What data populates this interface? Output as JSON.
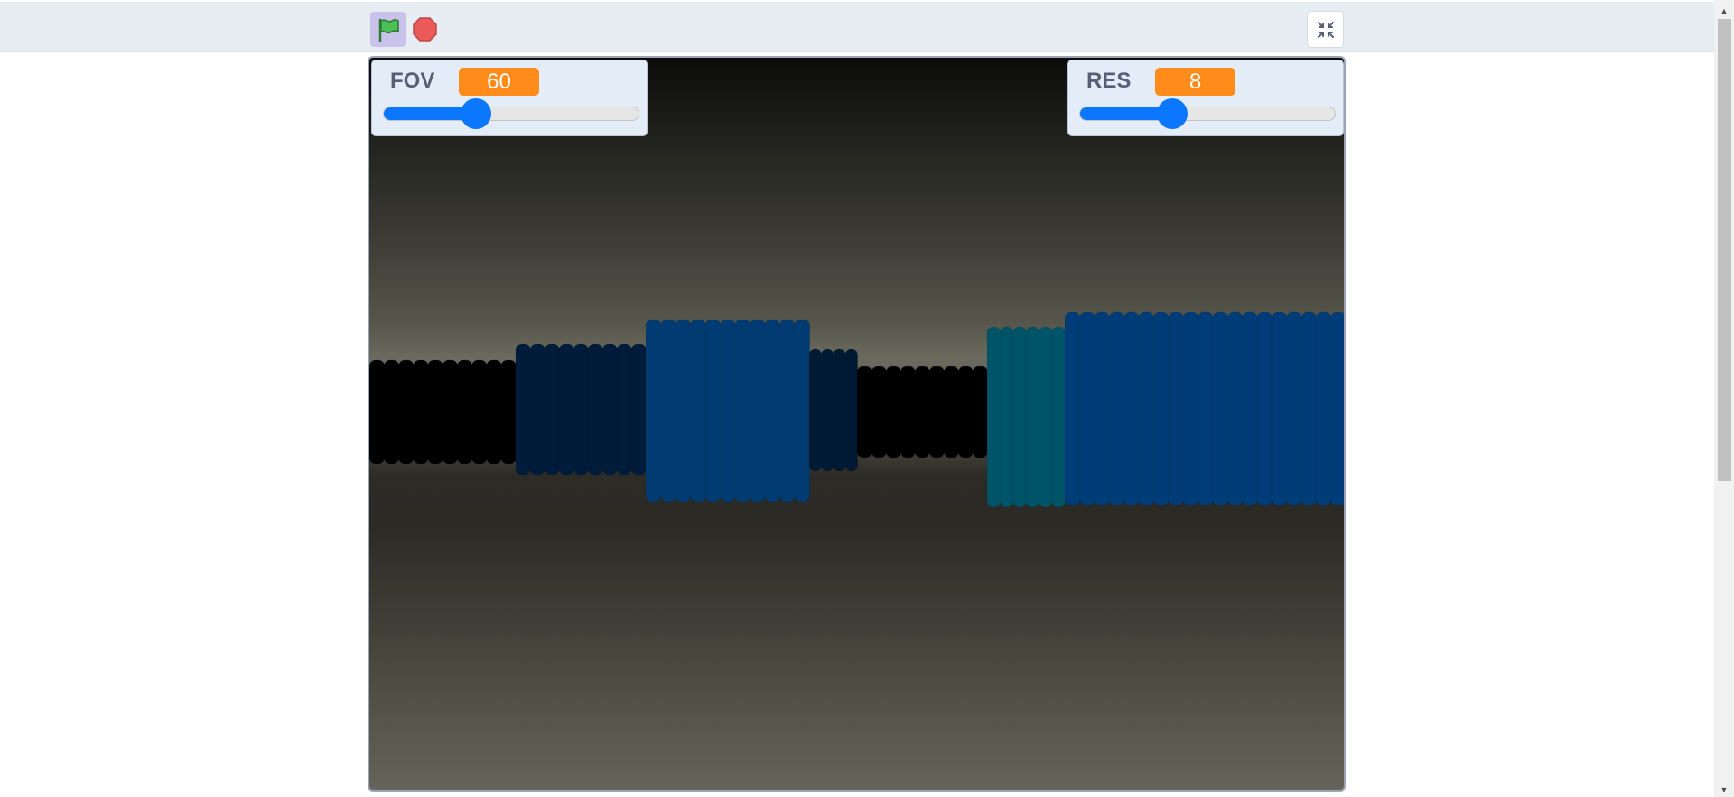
{
  "toolbar": {
    "green_flag_icon": "green-flag-icon",
    "stop_icon": "stop-sign-icon",
    "fullscreen_icon": "unfullscreen-icon"
  },
  "monitors": {
    "fov": {
      "label": "FOV",
      "value": "60",
      "slider_fraction": 0.36
    },
    "res": {
      "label": "RES",
      "value": "8",
      "slider_fraction": 0.36
    }
  },
  "colors": {
    "accent_orange": "#ff8c1a",
    "slider_blue": "#0b77ff",
    "flag_green": "#4cbf56",
    "stop_red": "#ec5959",
    "wall_blue": "#003c78",
    "wall_teal": "#005f70"
  }
}
